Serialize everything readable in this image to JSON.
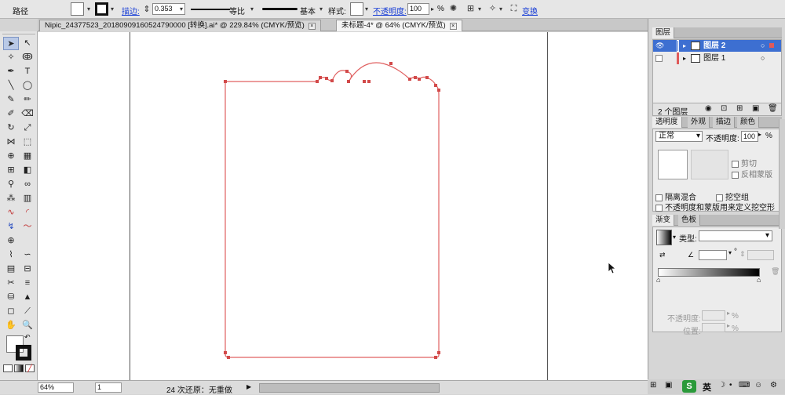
{
  "control_bar": {
    "object_type": "路径",
    "stroke_label": "描边:",
    "stroke_weight": "0.353",
    "profile_label": "等比",
    "brush_label": "基本",
    "style_label": "样式:",
    "opacity_label": "不透明度:",
    "opacity_value": "100",
    "opacity_unit": "%",
    "transform_label": "变换"
  },
  "doc_tabs": [
    {
      "label": "Nipic_24377523_20180909160524790000 [转换].ai* @ 229.84% (CMYK/预览)"
    },
    {
      "label": "未标题-4* @ 64% (CMYK/预览)"
    }
  ],
  "status_bar": {
    "zoom": "64%",
    "artboard": "1",
    "history": "24 次还原：无重做"
  },
  "layers_panel": {
    "title": "图层",
    "layers": [
      {
        "name": "图层 2",
        "selected": true,
        "color": "#3d6fd1"
      },
      {
        "name": "图层 1",
        "selected": false,
        "color": "#e05a5a"
      }
    ],
    "count": "2 个图层"
  },
  "transparency_panel": {
    "tabs": [
      "透明度",
      "外观",
      "描边",
      "颜色"
    ],
    "blend_mode": "正常",
    "opacity_label": "不透明度:",
    "opacity_value": "100",
    "opacity_unit": "%",
    "clip_label": "剪切",
    "invert_label": "反相蒙版",
    "isolate_label": "隔离混合",
    "knockout_label": "挖空组",
    "opacity_mask_label": "不透明度和蒙版用来定义挖空形状"
  },
  "gradient_panel": {
    "tabs": [
      "渐变",
      "色板"
    ],
    "type_label": "类型:",
    "angle_unit": "°",
    "opacity_label": "不透明度:",
    "location_label": "位置:",
    "percent": "%"
  },
  "taskbar": {
    "ime": "英"
  },
  "colors": {
    "path_stroke": "#e06060",
    "anchor": "#d24a4a",
    "selection": "#3d6fd1",
    "link": "#1a3fd6"
  }
}
